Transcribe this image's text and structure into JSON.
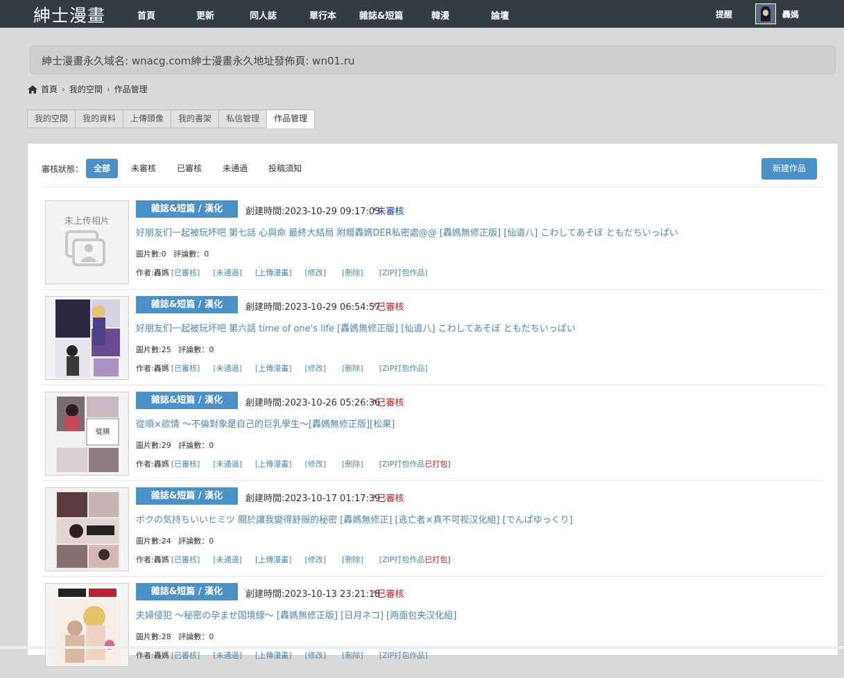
{
  "app": {
    "logo": "紳士漫畫",
    "notify": "提醒",
    "username": "轟媽"
  },
  "nav": [
    "首頁",
    "更新",
    "同人誌",
    "單行本",
    "雜誌&短篇",
    "韓漫",
    "論壇"
  ],
  "domain_notice": "紳士漫畫永久域名: wnacg.com紳士漫畫永久地址發佈頁: wn01.ru",
  "breadcrumb": [
    "首頁",
    "我的空間",
    "作品管理"
  ],
  "tabs": [
    "我的空間",
    "我的資料",
    "上傳頭像",
    "我的書架",
    "私信管理",
    "作品管理"
  ],
  "active_tab": "作品管理",
  "filter": {
    "label": "審核狀態：",
    "options": [
      "全部",
      "未審核",
      "已審核",
      "未通過",
      "投稿須知"
    ],
    "active": "全部"
  },
  "new_button": "新建作品",
  "placeholder_text": "未上传相片",
  "colors": {
    "accent": "#4a90c9",
    "approved": "#c32020",
    "pending": "#1a3ea8",
    "link": "#4a86ac",
    "topbar": "#333c40"
  },
  "items": [
    {
      "category": "雜誌&短篇 / 漢化",
      "created": "創建時間:2023-10-29 09:17:03",
      "status": "*未審核",
      "title": "好朋友们一起被玩坏吧 第七話 心與命 最終大結局 附贈轟媽DER私密處@@ [轟媽無修正版] [仙道八] こわしてあそぼ ともだちいっぱい",
      "pics": "圖片數:0",
      "comments": "評論數：0",
      "author": "作者:轟媽",
      "actions": [
        "[已審核]",
        "[未通過]",
        "[上傳漫畫]",
        "[修改]",
        "[刪除]",
        "[ZIP打包作品]"
      ],
      "packed": ""
    },
    {
      "category": "雜誌&短篇 / 漢化",
      "created": "創建時間:2023-10-29 06:54:57",
      "status": "*已審核",
      "title": "好朋友们一起被玩坏吧 第六話 time of one's life [轟媽無修正版] [仙道八] こわしてあそぼ ともだちいっぱい",
      "pics": "圖片數:25",
      "comments": "評論數：0",
      "author": "作者:轟媽",
      "actions": [
        "[已審核]",
        "[未通過]",
        "[上傳漫畫]",
        "[修改]",
        "[刪除]",
        "[ZIP打包作品]"
      ],
      "packed": ""
    },
    {
      "category": "雜誌&短篇 / 漢化",
      "created": "創建時間:2023-10-26 05:26:36",
      "status": "*已審核",
      "title": "從順×欲情 ～不倫對象是自己的巨乳學生～[轟媽無修正版][松果]",
      "pics": "圖片數:29",
      "comments": "評論數：0",
      "author": "作者:轟媽",
      "actions": [
        "[已審核]",
        "[未通過]",
        "[上傳漫畫]",
        "[修改]",
        "[刪除]",
        "[ZIP打包作品"
      ],
      "packed": "已打包]"
    },
    {
      "category": "雜誌&短篇 / 漢化",
      "created": "創建時間:2023-10-17 01:17:39",
      "status": "*已審核",
      "title": "ボクの気持ちいいヒミツ 關於讓我變得舒服的秘密 [轟媽無修正] [逃亡者×真不可视汉化組] [でんぱゆっくり]",
      "pics": "圖片數:24",
      "comments": "評論數：0",
      "author": "作者:轟媽",
      "actions": [
        "[已審核]",
        "[未通過]",
        "[上傳漫畫]",
        "[修改]",
        "[刪除]",
        "[ZIP打包作品"
      ],
      "packed": "已打包]"
    },
    {
      "category": "雜誌&短篇 / 漢化",
      "created": "創建時間:2023-10-13 23:21:18",
      "status": "*已審核",
      "title": "夫婦侵犯 ～秘密の孕ませ国境線～ [轟媽無修正版] [日月ネコ] [两面包夹汉化組]",
      "pics": "圖片數:28",
      "comments": "評論數：0",
      "author": "作者:轟媽",
      "actions": [
        "[已審核]",
        "[未通過]",
        "[上傳漫畫]",
        "[修改]",
        "[刪除]",
        "[ZIP打包作品]"
      ],
      "packed": ""
    }
  ]
}
